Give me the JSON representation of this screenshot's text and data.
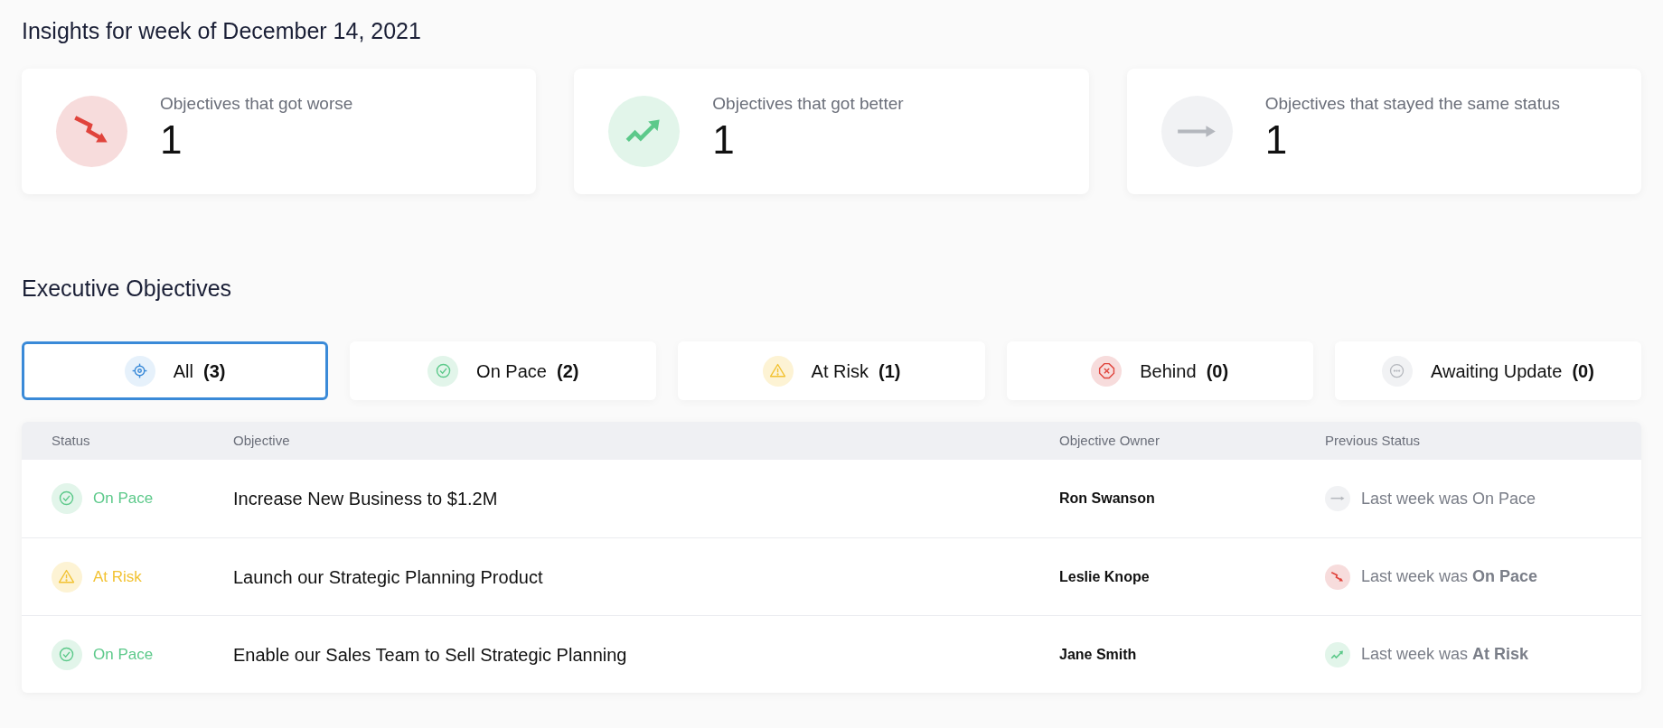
{
  "insights": {
    "title": "Insights for week of December 14, 2021",
    "cards": [
      {
        "kind": "worse",
        "label": "Objectives that got worse",
        "count": "1"
      },
      {
        "kind": "better",
        "label": "Objectives that got better",
        "count": "1"
      },
      {
        "kind": "same",
        "label": "Objectives that stayed the same status",
        "count": "1"
      }
    ]
  },
  "objectives": {
    "title": "Executive Objectives",
    "tabs": [
      {
        "kind": "all",
        "label": "All",
        "count": "(3)",
        "selected": true
      },
      {
        "kind": "on_pace",
        "label": "On Pace",
        "count": "(2)",
        "selected": false
      },
      {
        "kind": "at_risk",
        "label": "At Risk",
        "count": "(1)",
        "selected": false
      },
      {
        "kind": "behind",
        "label": "Behind",
        "count": "(0)",
        "selected": false
      },
      {
        "kind": "awaiting",
        "label": "Awaiting Update",
        "count": "(0)",
        "selected": false
      }
    ],
    "table": {
      "columns": [
        "Status",
        "Objective",
        "Objective Owner",
        "Previous Status"
      ],
      "rows": [
        {
          "status": {
            "kind": "on_pace",
            "label": "On Pace"
          },
          "objective": "Increase New Business to $1.2M",
          "owner": "Ron Swanson",
          "previous": {
            "kind": "same",
            "text": "Last week was On Pace"
          }
        },
        {
          "status": {
            "kind": "at_risk",
            "label": "At Risk"
          },
          "objective": "Launch our Strategic Planning Product",
          "owner": "Leslie Knope",
          "previous": {
            "kind": "worse",
            "text": "Last week was **On Pace**"
          }
        },
        {
          "status": {
            "kind": "on_pace",
            "label": "On Pace"
          },
          "objective": "Enable our Sales Team to Sell Strategic Planning",
          "owner": "Jane Smith",
          "previous": {
            "kind": "better",
            "text": "Last week was **At Risk**"
          }
        }
      ]
    }
  }
}
